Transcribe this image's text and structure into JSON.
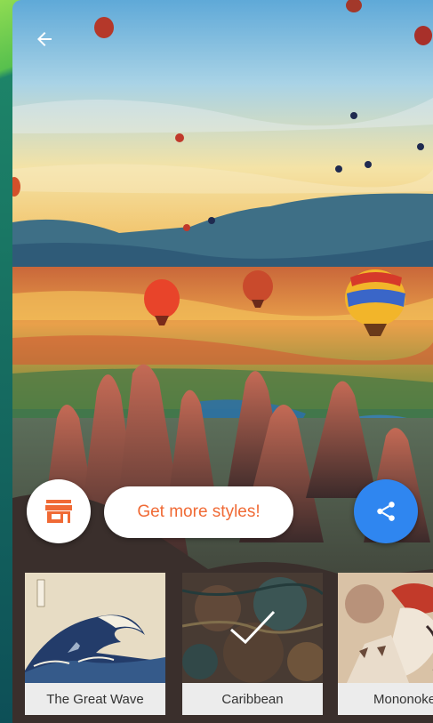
{
  "screen": {
    "back_icon": "arrow-left-icon",
    "store_icon": "store-icon",
    "share_icon": "share-icon"
  },
  "promo": {
    "label": "Get more styles!"
  },
  "styles": [
    {
      "name": "The Great Wave",
      "selected": false
    },
    {
      "name": "Caribbean",
      "selected": true
    },
    {
      "name": "Mononoke",
      "selected": false
    }
  ],
  "colors": {
    "accent_orange": "#f06a35",
    "share_blue": "#2f86f0",
    "label_bg": "#ececec"
  }
}
